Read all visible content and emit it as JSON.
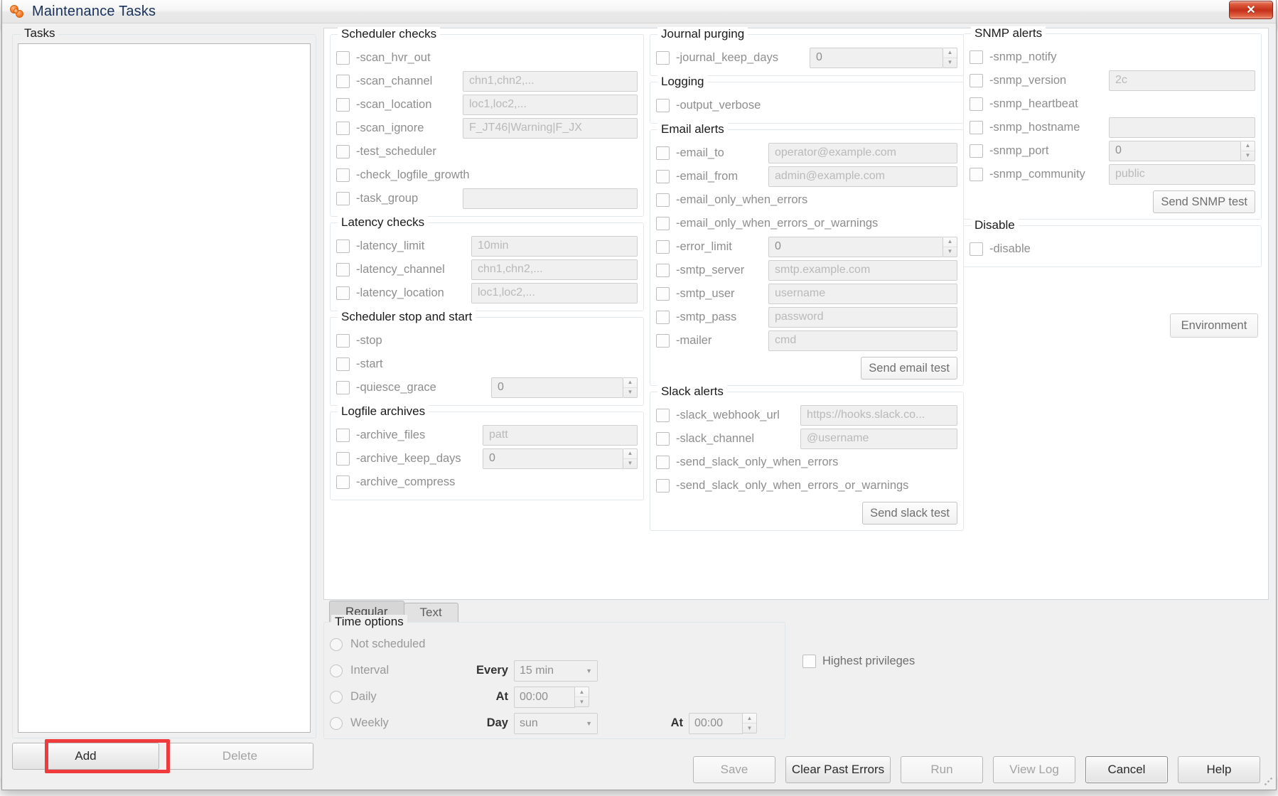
{
  "window": {
    "title": "Maintenance Tasks",
    "close_label": "✕",
    "icon": "tasks-icon"
  },
  "tasks_panel": {
    "legend": "Tasks",
    "items": [],
    "add_label": "Add",
    "delete_label": "Delete",
    "highlight_color": "#ef3b3b"
  },
  "groups": {
    "scheduler_checks": {
      "legend": "Scheduler checks",
      "rows": [
        {
          "label": "-scan_hvr_out",
          "field": null
        },
        {
          "label": "-scan_channel",
          "field": "",
          "placeholder": "chn1,chn2,..."
        },
        {
          "label": "-scan_location",
          "field": "",
          "placeholder": "loc1,loc2,..."
        },
        {
          "label": "-scan_ignore",
          "field": "",
          "placeholder": "F_JT46|Warning|F_JX"
        },
        {
          "label": "-test_scheduler",
          "field": null
        },
        {
          "label": "-check_logfile_growth",
          "field": null
        },
        {
          "label": "-task_group",
          "field": "",
          "placeholder": ""
        }
      ]
    },
    "latency_checks": {
      "legend": "Latency checks",
      "rows": [
        {
          "label": "-latency_limit",
          "field": "",
          "placeholder": "10min"
        },
        {
          "label": "-latency_channel",
          "field": "",
          "placeholder": "chn1,chn2,..."
        },
        {
          "label": "-latency_location",
          "field": "",
          "placeholder": "loc1,loc2,..."
        }
      ]
    },
    "scheduler_stop_start": {
      "legend": "Scheduler stop and start",
      "rows": [
        {
          "label": "-stop",
          "field": null
        },
        {
          "label": "-start",
          "field": null
        },
        {
          "label": "-quiesce_grace",
          "value": "0",
          "spinner": true
        }
      ]
    },
    "logfile_archives": {
      "legend": "Logfile archives",
      "rows": [
        {
          "label": "-archive_files",
          "field": "",
          "placeholder": "patt"
        },
        {
          "label": "-archive_keep_days",
          "value": "0",
          "spinner": true
        },
        {
          "label": "-archive_compress",
          "field": null
        }
      ]
    },
    "journal_purging": {
      "legend": "Journal purging",
      "rows": [
        {
          "label": "-journal_keep_days",
          "value": "0",
          "spinner": true
        }
      ]
    },
    "logging": {
      "legend": "Logging",
      "rows": [
        {
          "label": "-output_verbose",
          "field": null
        }
      ]
    },
    "email_alerts": {
      "legend": "Email alerts",
      "button": "Send email test",
      "rows": [
        {
          "label": "-email_to",
          "field": "",
          "placeholder": "operator@example.com"
        },
        {
          "label": "-email_from",
          "field": "",
          "placeholder": "admin@example.com"
        },
        {
          "label": "-email_only_when_errors",
          "field": null
        },
        {
          "label": "-email_only_when_errors_or_warnings",
          "field": null
        },
        {
          "label": "-error_limit",
          "value": "0",
          "spinner": true
        },
        {
          "label": "-smtp_server",
          "field": "",
          "placeholder": "smtp.example.com"
        },
        {
          "label": "-smtp_user",
          "field": "",
          "placeholder": "username"
        },
        {
          "label": "-smtp_pass",
          "field": "",
          "placeholder": "password"
        },
        {
          "label": "-mailer",
          "field": "",
          "placeholder": "cmd"
        }
      ]
    },
    "slack_alerts": {
      "legend": "Slack alerts",
      "button": "Send slack test",
      "rows": [
        {
          "label": "-slack_webhook_url",
          "field": "",
          "placeholder": "https://hooks.slack.co..."
        },
        {
          "label": "-slack_channel",
          "field": "",
          "placeholder": "@username"
        },
        {
          "label": "-send_slack_only_when_errors",
          "field": null
        },
        {
          "label": "-send_slack_only_when_errors_or_warnings",
          "field": null
        }
      ]
    },
    "snmp_alerts": {
      "legend": "SNMP alerts",
      "button": "Send SNMP test",
      "rows": [
        {
          "label": "-snmp_notify",
          "field": null
        },
        {
          "label": "-snmp_version",
          "field": "",
          "placeholder": "2c"
        },
        {
          "label": "-snmp_heartbeat",
          "field": null
        },
        {
          "label": "-snmp_hostname",
          "field": "",
          "placeholder": ""
        },
        {
          "label": "-snmp_port",
          "value": "0",
          "spinner": true
        },
        {
          "label": "-snmp_community",
          "field": "",
          "placeholder": "public"
        }
      ]
    },
    "disable": {
      "legend": "Disable",
      "rows": [
        {
          "label": "-disable",
          "field": null
        }
      ]
    }
  },
  "environment_button": "Environment",
  "tabs": [
    {
      "label": "Regular",
      "active": true
    },
    {
      "label": "Text",
      "active": false
    }
  ],
  "time_options": {
    "legend": "Time options",
    "options": [
      {
        "label": "Not scheduled",
        "selected": false
      },
      {
        "label": "Interval",
        "selected": false,
        "caption": "Every",
        "combo": "15 min"
      },
      {
        "label": "Daily",
        "selected": false,
        "caption": "At",
        "field": "00:00"
      },
      {
        "label": "Weekly",
        "selected": false,
        "caption": "Day",
        "combo": "sun",
        "caption2": "At",
        "field2": "00:00"
      }
    ]
  },
  "privileges": {
    "label": "Highest privileges",
    "checked": false
  },
  "bottom_buttons": [
    {
      "label": "Save",
      "enabled": false
    },
    {
      "label": "Clear Past Errors",
      "enabled": true
    },
    {
      "label": "Run",
      "enabled": false
    },
    {
      "label": "View Log",
      "enabled": false
    },
    {
      "label": "Cancel",
      "enabled": true,
      "default": true
    },
    {
      "label": "Help",
      "enabled": true
    }
  ]
}
